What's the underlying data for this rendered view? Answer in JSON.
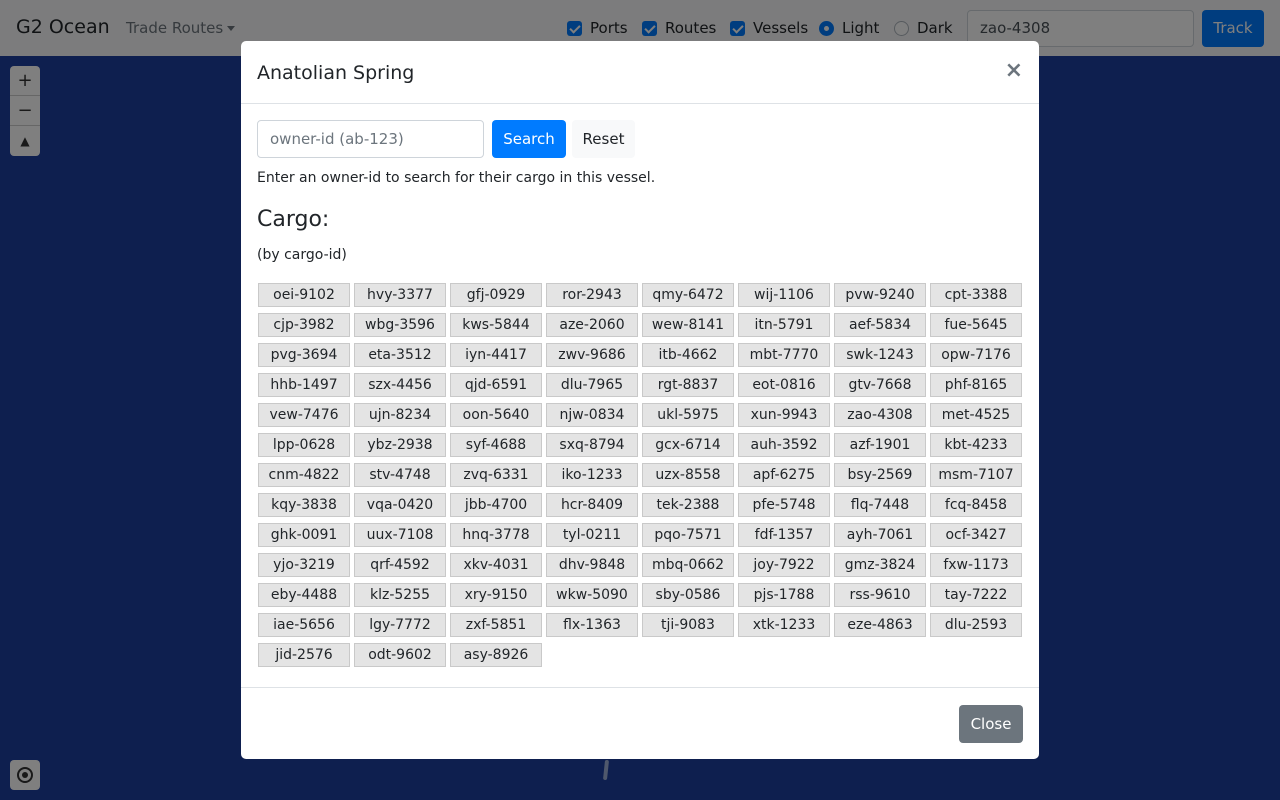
{
  "navbar": {
    "brand": "G2 Ocean",
    "dropdown_label": "Trade Routes",
    "toggles": [
      {
        "label": "Ports",
        "checked": true
      },
      {
        "label": "Routes",
        "checked": true
      },
      {
        "label": "Vessels",
        "checked": true
      }
    ],
    "themes": [
      {
        "label": "Light",
        "selected": true
      },
      {
        "label": "Dark",
        "selected": false
      }
    ],
    "track_value": "zao-4308",
    "track_button": "Track"
  },
  "map_controls": {
    "zoom_in": "+",
    "zoom_out": "−",
    "compass": "▲"
  },
  "modal": {
    "title": "Anatolian Spring",
    "close_symbol": "×",
    "owner_placeholder": "owner-id (ab-123)",
    "search_label": "Search",
    "reset_label": "Reset",
    "hint": "Enter an owner-id to search for their cargo in this vessel.",
    "cargo_heading": "Cargo:",
    "cargo_subheading": "(by cargo-id)",
    "cargo_ids": [
      "oei-9102",
      "hvy-3377",
      "gfj-0929",
      "ror-2943",
      "qmy-6472",
      "wij-1106",
      "pvw-9240",
      "cpt-3388",
      "cjp-3982",
      "wbg-3596",
      "kws-5844",
      "aze-2060",
      "wew-8141",
      "itn-5791",
      "aef-5834",
      "fue-5645",
      "pvg-3694",
      "eta-3512",
      "iyn-4417",
      "zwv-9686",
      "itb-4662",
      "mbt-7770",
      "swk-1243",
      "opw-7176",
      "hhb-1497",
      "szx-4456",
      "qjd-6591",
      "dlu-7965",
      "rgt-8837",
      "eot-0816",
      "gtv-7668",
      "phf-8165",
      "vew-7476",
      "ujn-8234",
      "oon-5640",
      "njw-0834",
      "ukl-5975",
      "xun-9943",
      "zao-4308",
      "met-4525",
      "lpp-0628",
      "ybz-2938",
      "syf-4688",
      "sxq-8794",
      "gcx-6714",
      "auh-3592",
      "azf-1901",
      "kbt-4233",
      "cnm-4822",
      "stv-4748",
      "zvq-6331",
      "iko-1233",
      "uzx-8558",
      "apf-6275",
      "bsy-2569",
      "msm-7107",
      "kqy-3838",
      "vqa-0420",
      "jbb-4700",
      "hcr-8409",
      "tek-2388",
      "pfe-5748",
      "flq-7448",
      "fcq-8458",
      "ghk-0091",
      "uux-7108",
      "hnq-3778",
      "tyl-0211",
      "pqo-7571",
      "fdf-1357",
      "ayh-7061",
      "ocf-3427",
      "yjo-3219",
      "qrf-4592",
      "xkv-4031",
      "dhv-9848",
      "mbq-0662",
      "joy-7922",
      "gmz-3824",
      "fxw-1173",
      "eby-4488",
      "klz-5255",
      "xry-9150",
      "wkw-5090",
      "sby-0586",
      "pjs-1788",
      "rss-9610",
      "tay-7222",
      "iae-5656",
      "lgy-7772",
      "zxf-5851",
      "flx-1363",
      "tji-9083",
      "xtk-1233",
      "eze-4863",
      "dlu-2593",
      "jid-2576",
      "odt-9602",
      "asy-8926"
    ],
    "close_label": "Close"
  },
  "colors": {
    "primary": "#007bff",
    "secondary": "#6c757d",
    "map_water": "#1c3f9e",
    "chip_bg": "#e4e4e4"
  }
}
